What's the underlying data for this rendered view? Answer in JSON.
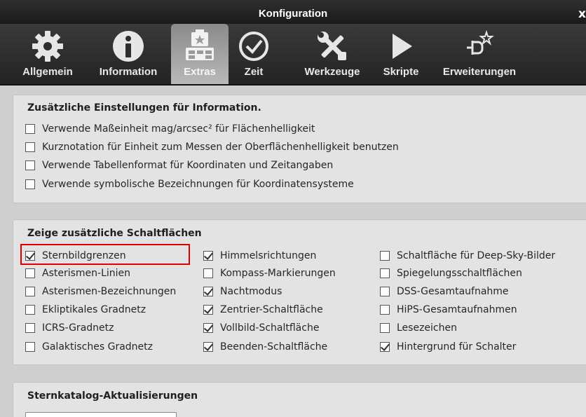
{
  "window": {
    "title": "Konfiguration",
    "close_glyph": "x"
  },
  "tabs": [
    {
      "label": "Allgemein",
      "icon": "gear-icon",
      "active": false
    },
    {
      "label": "Information",
      "icon": "info-icon",
      "active": false
    },
    {
      "label": "Extras",
      "icon": "puzzle-icon",
      "active": true
    },
    {
      "label": "Zeit",
      "icon": "clock-icon",
      "active": false
    },
    {
      "label": "Werkzeuge",
      "icon": "tools-icon",
      "active": false
    },
    {
      "label": "Skripte",
      "icon": "play-icon",
      "active": false
    },
    {
      "label": "Erweiterungen",
      "icon": "plugin-icon",
      "active": false
    }
  ],
  "info_section": {
    "title": "Zusätzliche Einstellungen für Information.",
    "options": [
      {
        "label": "Verwende Maßeinheit mag/arcsec² für Flächenhelligkeit",
        "checked": false
      },
      {
        "label": "Kurznotation für Einheit zum Messen der Oberflächenhelligkeit benutzen",
        "checked": false
      },
      {
        "label": "Verwende Tabellenformat für Koordinaten und Zeitangaben",
        "checked": false
      },
      {
        "label": "Verwende symbolische Bezeichnungen für Koordinatensysteme",
        "checked": false
      }
    ]
  },
  "buttons_section": {
    "title": "Zeige zusätzliche Schaltflächen",
    "col1": [
      {
        "label": "Sternbildgrenzen",
        "checked": true
      },
      {
        "label": "Asterismen-Linien",
        "checked": false
      },
      {
        "label": "Asterismen-Bezeichnungen",
        "checked": false
      },
      {
        "label": "Ekliptikales Gradnetz",
        "checked": false
      },
      {
        "label": "ICRS-Gradnetz",
        "checked": false
      },
      {
        "label": "Galaktisches Gradnetz",
        "checked": false
      }
    ],
    "col2": [
      {
        "label": "Himmelsrichtungen",
        "checked": true
      },
      {
        "label": "Kompass-Markierungen",
        "checked": false
      },
      {
        "label": "Nachtmodus",
        "checked": true
      },
      {
        "label": "Zentrier-Schaltfläche",
        "checked": true
      },
      {
        "label": "Vollbild-Schaltfläche",
        "checked": true
      },
      {
        "label": "Beenden-Schaltfläche",
        "checked": true
      }
    ],
    "col3": [
      {
        "label": "Schaltfläche für Deep-Sky-Bilder",
        "checked": false
      },
      {
        "label": "Spiegelungsschaltflächen",
        "checked": false
      },
      {
        "label": "DSS-Gesamtaufnahme",
        "checked": false
      },
      {
        "label": "HiPS-Gesamtaufnahmen",
        "checked": false
      },
      {
        "label": "Lesezeichen",
        "checked": false
      },
      {
        "label": "Hintergrund für Schalter",
        "checked": true
      }
    ]
  },
  "catalog_section": {
    "title": "Sternkatalog-Aktualisierungen"
  },
  "colors": {
    "highlight": "#e00000",
    "toolbar": "#2b2b2b",
    "panel": "#e3e3e3"
  }
}
